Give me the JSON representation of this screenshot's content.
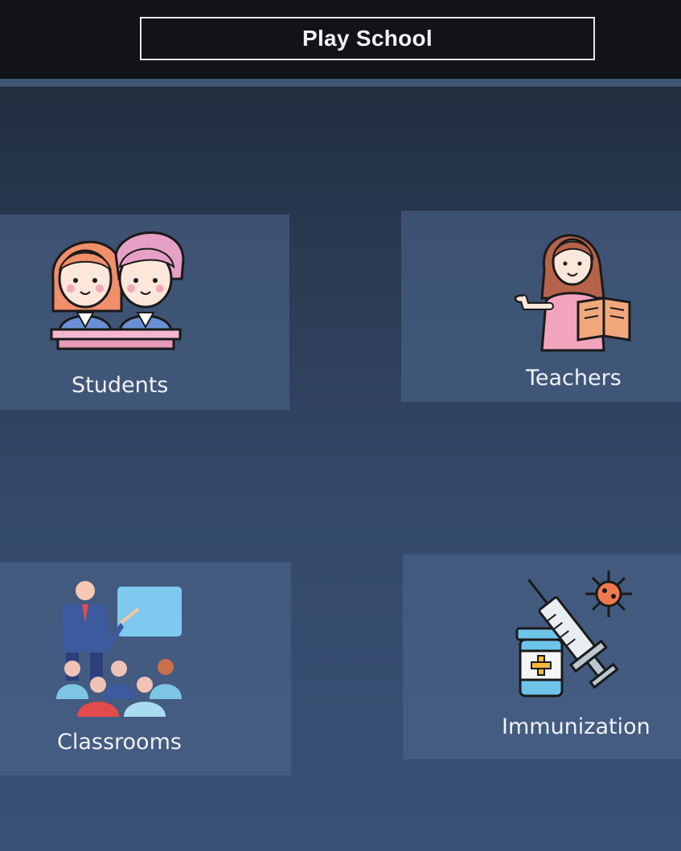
{
  "header": {
    "title": "Play School"
  },
  "tiles": [
    {
      "label": "Students",
      "icon": "students-icon"
    },
    {
      "label": "Teachers",
      "icon": "teacher-icon"
    },
    {
      "label": "Classrooms",
      "icon": "classroom-icon"
    },
    {
      "label": "Immunization",
      "icon": "vaccine-icon"
    }
  ],
  "colors": {
    "header_bg": "#111318",
    "page_bg": "#2e405c",
    "tile_bg": "#4e688e",
    "text": "#f0f2f6"
  }
}
